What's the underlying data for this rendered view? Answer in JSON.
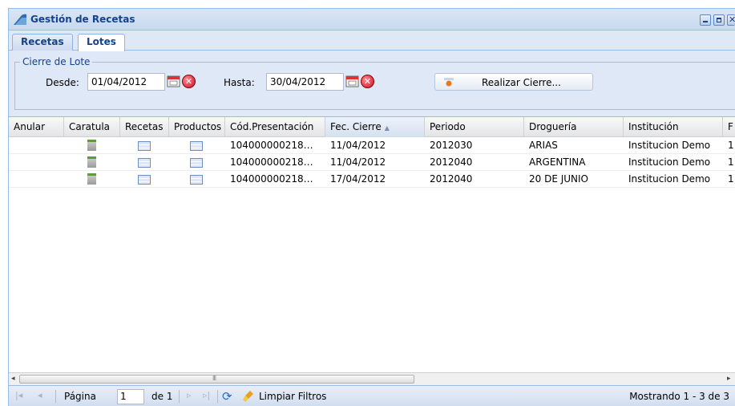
{
  "window": {
    "title": "Gestión de Recetas",
    "tools": [
      "minimize-icon",
      "maximize-icon",
      "close-icon"
    ],
    "close_glyph": "✕"
  },
  "tabs": [
    {
      "label": "Recetas",
      "active": false
    },
    {
      "label": "Lotes",
      "active": true
    }
  ],
  "filter": {
    "legend": "Cierre de Lote",
    "desde_label": "Desde:",
    "desde_value": "01/04/2012",
    "hasta_label": "Hasta:",
    "hasta_value": "30/04/2012",
    "action_label": "Realizar Cierre..."
  },
  "grid": {
    "columns": [
      "Anular",
      "Caratula",
      "Recetas",
      "Productos",
      "Cód.Presentación",
      "Fec. Cierre",
      "Periodo",
      "Droguería",
      "Institución",
      "F"
    ],
    "sorted_column": "Fec. Cierre",
    "sort_direction": "ascending",
    "rows": [
      {
        "cod": "104000000218…",
        "fecha": "11/04/2012",
        "periodo": "2012030",
        "drogueria": "ARIAS",
        "institucion": "Institucion Demo",
        "extra": "1"
      },
      {
        "cod": "104000000218…",
        "fecha": "11/04/2012",
        "periodo": "2012040",
        "drogueria": "ARGENTINA",
        "institucion": "Institucion Demo",
        "extra": "1"
      },
      {
        "cod": "104000000218…",
        "fecha": "17/04/2012",
        "periodo": "2012040",
        "drogueria": "20 DE JUNIO",
        "institucion": "Institucion Demo",
        "extra": "1"
      }
    ]
  },
  "scroll": {
    "grip": "III",
    "left_arrow": "◂",
    "right_arrow": "▸"
  },
  "pager": {
    "page_label": "Página",
    "page_value": "1",
    "of_label": "de 1",
    "clear_filters": "Limpiar Filtros",
    "status": "Mostrando 1 - 3 de 3",
    "first_glyph": "|◂",
    "prev_glyph": "◂",
    "next_glyph": "▹",
    "last_glyph": "▹|",
    "refresh_glyph": "⟳"
  },
  "colors": {
    "accent": "#15428b",
    "panel_bg": "#dfe8f6",
    "border": "#99bbe8"
  }
}
